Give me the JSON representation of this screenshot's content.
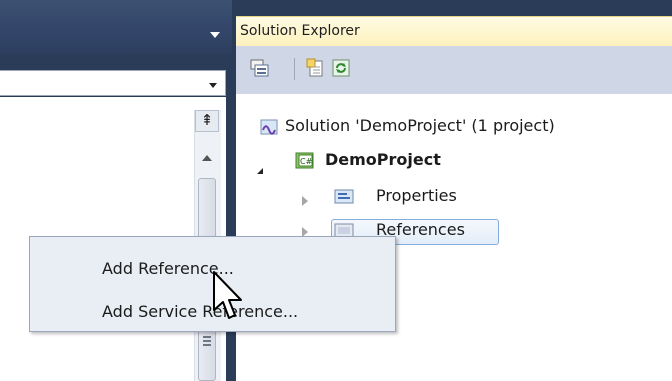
{
  "solution_explorer": {
    "title": "Solution Explorer",
    "toolbar": [
      {
        "name": "properties-icon"
      },
      {
        "name": "show-all-files-icon"
      },
      {
        "name": "refresh-icon"
      }
    ],
    "tree": {
      "solution_label": "Solution 'DemoProject' (1 project)",
      "project_label": "DemoProject",
      "properties_label": "Properties",
      "references_label": "References"
    }
  },
  "context_menu": {
    "items": [
      {
        "label": "Add Reference..."
      },
      {
        "label": "Add Service Reference..."
      }
    ]
  },
  "colors": {
    "ide_chrome": "#2b3c59",
    "se_title_bg": "#fdf1bd",
    "se_toolbar_bg": "#cfd6e5",
    "menu_bg": "#e9edf4",
    "selection_border": "#84acdd"
  }
}
